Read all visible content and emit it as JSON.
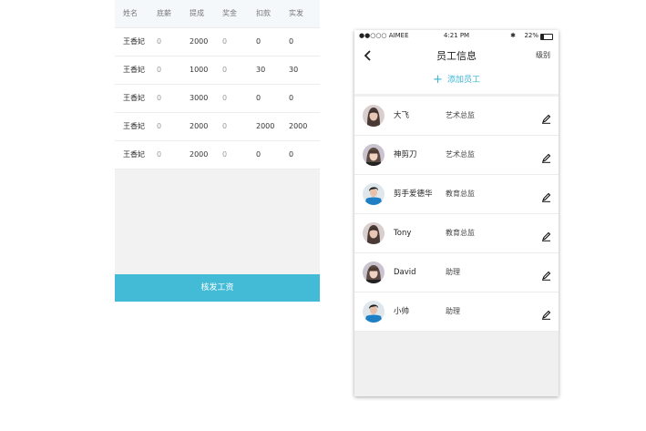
{
  "salary": {
    "headers": [
      "姓名",
      "底薪",
      "提成",
      "奖金",
      "扣款",
      "实发"
    ],
    "rows": [
      [
        "王香妃",
        "0",
        "2000",
        "0",
        "0",
        "0"
      ],
      [
        "王香妃",
        "0",
        "1000",
        "0",
        "30",
        "30"
      ],
      [
        "王香妃",
        "0",
        "3000",
        "0",
        "0",
        "0"
      ],
      [
        "王香妃",
        "0",
        "2000",
        "0",
        "2000",
        "2000"
      ],
      [
        "王香妃",
        "0",
        "2000",
        "0",
        "0",
        "0"
      ]
    ],
    "pay_button": "核发工资",
    "accent_color": "#44bbd6"
  },
  "phone": {
    "status": {
      "carrier": "●●○○○ AIMEE",
      "time": "4:21 PM",
      "battery": "22%"
    },
    "nav": {
      "title": "员工信息",
      "level": "级别",
      "back_icon": "chevron-left-icon"
    },
    "add_label": "添加员工",
    "employees": [
      {
        "name": "大飞",
        "role": "艺术总监",
        "avatar": "avatar-woman-dark-hair"
      },
      {
        "name": "神剪刀",
        "role": "艺术总监",
        "avatar": "avatar-woman-bangs"
      },
      {
        "name": "剪手爱德华",
        "role": "教育总监",
        "avatar": "avatar-man-blue"
      },
      {
        "name": "Tony",
        "role": "教育总监",
        "avatar": "avatar-woman-dark-hair"
      },
      {
        "name": "David",
        "role": "助理",
        "avatar": "avatar-woman-bangs"
      },
      {
        "name": "小帅",
        "role": "助理",
        "avatar": "avatar-man-blue"
      }
    ],
    "accent_color": "#3bb6d3"
  }
}
